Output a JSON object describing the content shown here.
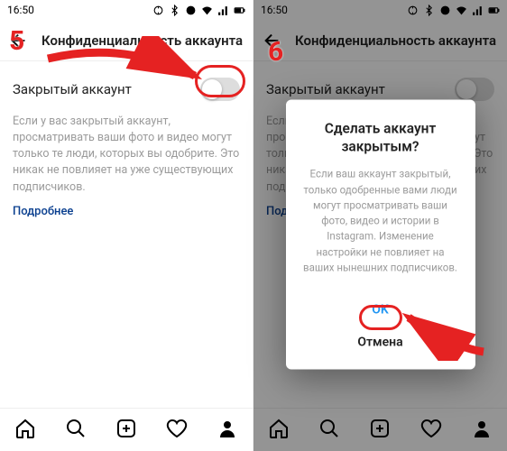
{
  "statusbar": {
    "time": "16:50"
  },
  "header": {
    "title": "Конфиденциальность аккаунта"
  },
  "privacy": {
    "private_account_label": "Закрытый аккаунт",
    "description": "Если у вас закрытый аккаунт, просматривать ваши фото и видео могут только те люди, которых вы одобрите. Это никак не повлияет на уже существующих подписчиков.",
    "more_link": "Подробнее"
  },
  "dialog": {
    "title": "Сделать аккаунт закрытым?",
    "body": "Если ваш аккаунт закрытый, только одобренные вами люди могут просматривать ваши фото, видео и истории в Instagram. Изменение настройки не повлияет на ваших нынешних подписчиков.",
    "ok": "OK",
    "cancel": "Отмена"
  },
  "annotations": {
    "step5": "5",
    "step6": "6"
  },
  "nav": {
    "home": "home-icon",
    "search": "search-icon",
    "add": "add-icon",
    "activity": "heart-icon",
    "profile": "profile-icon"
  }
}
